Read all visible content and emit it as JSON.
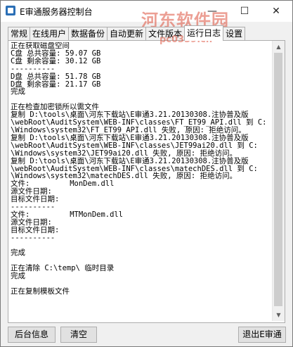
{
  "window": {
    "title": "E审通服务器控制台",
    "watermark_text": "河东软件园",
    "watermark_url": "pc0359.cn"
  },
  "title_controls": {
    "minimize": "—",
    "maximize": "☐",
    "close": "✕"
  },
  "tabs": [
    "常规",
    "在线用户",
    "数据备份",
    "自动更新",
    "文件版本",
    "运行日志",
    "设置"
  ],
  "active_tab": "运行日志",
  "log_lines": [
    "正在获取磁盘空间",
    "C盘 总共容量: 59.07 GB",
    "C盘 剩余容量: 30.12 GB",
    "----------",
    "D盘 总共容量: 51.78 GB",
    "D盘 剩余容量: 21.17 GB",
    "完成",
    "",
    "正在检查加密锁所以需文件",
    "复制 D:\\tools\\桌面\\河东下载站\\E审通3.21.20130308.注协普及版",
    "\\webRoot\\AuditSystem\\WEB-INF\\classes\\FT_ET99_API.dll 到 C:",
    "\\Windows\\system32\\FT_ET99_API.dll 失败, 原因: 拒绝访问。",
    "复制 D:\\tools\\桌面\\河东下载站\\E审通3.21.20130308.注协普及版",
    "\\webRoot\\AuditSystem\\WEB-INF\\classes\\JET99ai20.dll 到 C:",
    "\\Windows\\system32\\JET99ai20.dll 失败, 原因: 拒绝访问。",
    "复制 D:\\tools\\桌面\\河东下载站\\E审通3.21.20130308.注协普及版",
    "\\webRoot\\AuditSystem\\WEB-INF\\classes\\matechDES.dll 到 C:",
    "\\Windows\\system32\\matechDES.dll 失败, 原因: 拒绝访问。",
    "文件:         MonDem.dll",
    "源文件日期:",
    "目标文件日期:",
    "----------",
    "文件:         MTMonDem.dll",
    "源文件日期:",
    "目标文件日期:",
    "----------",
    "",
    "完成",
    "",
    "正在清除 C:\\temp\\ 临时目录",
    "完成",
    "",
    "正在复制模板文件"
  ],
  "buttons": {
    "info": "后台信息",
    "clear": "清空",
    "exit": "退出E审通"
  }
}
